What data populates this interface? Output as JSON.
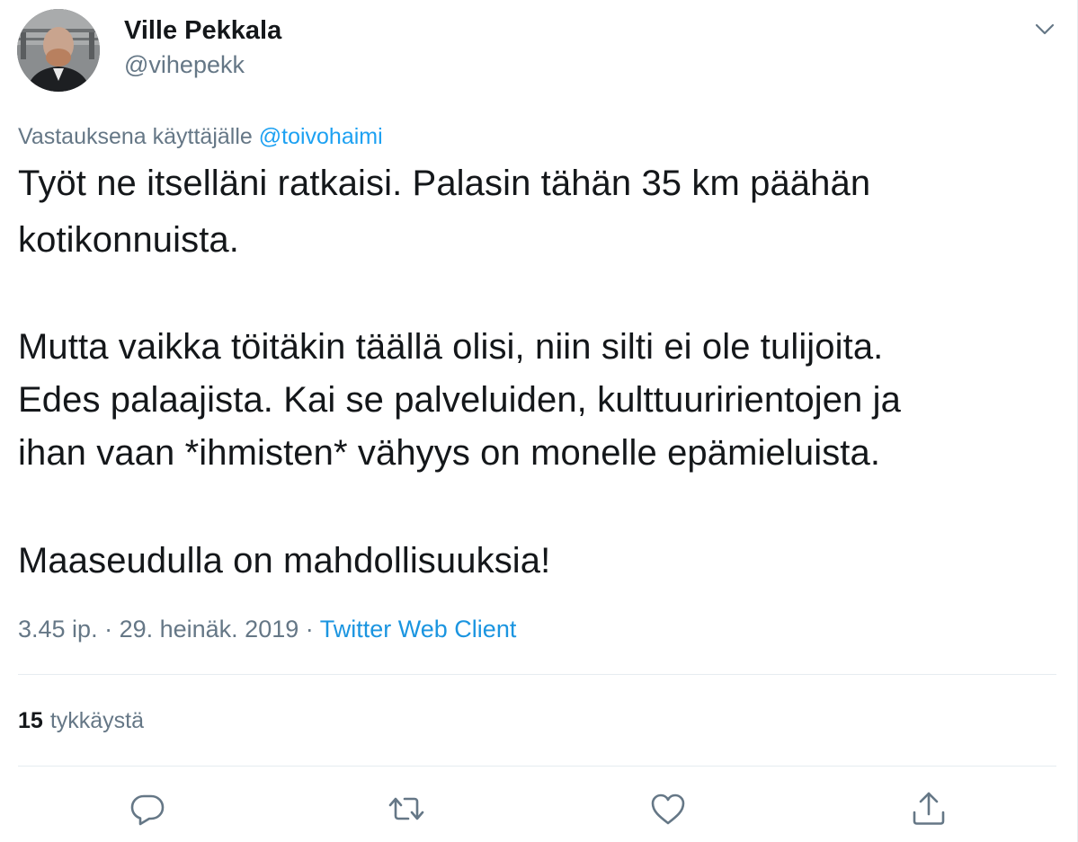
{
  "author": {
    "name": "Ville Pekkala",
    "handle": "@vihepekk"
  },
  "reply": {
    "prefix": "Vastauksena käyttäjälle ",
    "mention": "@toivohaimi"
  },
  "body_lines": [
    "Työt ne itselläni ratkaisi. Palasin tähän 35 km päähän",
    "kotikonnuista.",
    "Mutta vaikka töitäkin täällä olisi, niin silti ei ole tulijoita.",
    "Edes palaajista. Kai se palveluiden, kulttuuririentojen ja",
    "ihan vaan *ihmisten* vähyys on monelle epämieluista.",
    "Maaseudulla on mahdollisuuksia!"
  ],
  "meta": {
    "time": "3.45 ip.",
    "date": "29. heinäk. 2019",
    "separator": " · ",
    "source": "Twitter Web Client"
  },
  "likes": {
    "count": "15",
    "label": "tykkäystä"
  },
  "actions": [
    {
      "icon": "reply-icon"
    },
    {
      "icon": "retweet-icon"
    },
    {
      "icon": "like-icon"
    },
    {
      "icon": "share-icon"
    }
  ],
  "colors": {
    "accent": "#1da1f2",
    "muted": "#657786",
    "text": "#14171a",
    "border": "#e6ecf0"
  }
}
